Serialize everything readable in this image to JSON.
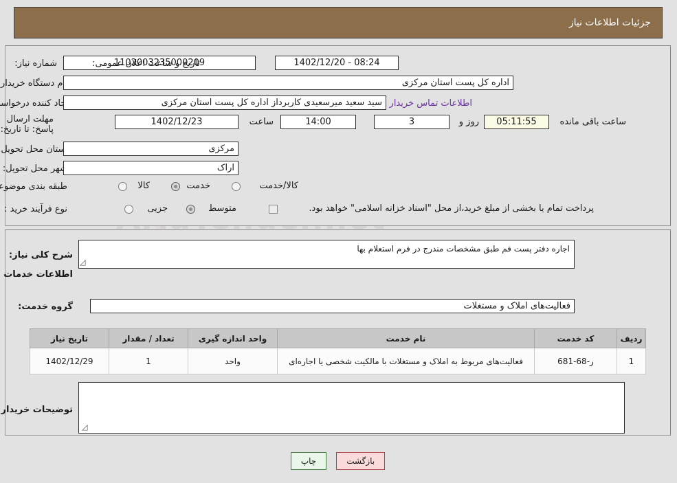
{
  "header": {
    "title": "جزئیات اطلاعات نیاز",
    "bg_color": "#8d6e4b"
  },
  "watermark": {
    "text": "AriaTender.net"
  },
  "form": {
    "need_number": {
      "label": "شماره نیاز:",
      "value": "1102003235000209"
    },
    "announce_datetime": {
      "label": "تاریخ و ساعت اعلان عمومی:",
      "value": "08:24 - 1402/12/20"
    },
    "buyer_org": {
      "label": "نام دستگاه خریدار:",
      "value": "اداره کل پست استان مرکزی"
    },
    "request_creator": {
      "label": "ایجاد کننده درخواست:",
      "value": "سید سعید میرسعیدی کاربرداز اداره کل پست استان مرکزی"
    },
    "buyer_contact_link": {
      "label": "اطلاعات تماس خریدار",
      "color": "#6b2fa5"
    },
    "deadline": {
      "label": "مهلت ارسال پاسخ: تا تاریخ:",
      "date": "1402/12/23",
      "time_label": "ساعت",
      "time": "14:00",
      "days": "3",
      "days_suffix": "روز و",
      "countdown": "05:11:55",
      "countdown_suffix": "ساعت باقی مانده"
    },
    "delivery_province": {
      "label": "استان محل تحویل:",
      "value": "مرکزی"
    },
    "delivery_city": {
      "label": "شهر محل تحویل:",
      "value": "اراک"
    },
    "subject_category": {
      "label": "طبقه بندی موضوعی:",
      "options": [
        {
          "label": "کالا",
          "selected": false
        },
        {
          "label": "خدمت",
          "selected": true
        },
        {
          "label": "کالا/خدمت",
          "selected": false
        }
      ]
    },
    "purchase_process": {
      "label": "نوع فرآیند خرید :",
      "options": [
        {
          "label": "جزیی",
          "selected": false
        },
        {
          "label": "متوسط",
          "selected": true
        }
      ]
    },
    "treasury_note": {
      "checked": false,
      "text": "پرداخت تمام یا بخشی از مبلغ خرید،از محل \"اسناد خزانه اسلامی\" خواهد بود."
    },
    "general_description": {
      "label": "شرح کلی نیاز:",
      "value": "اجاره دفتر پست فم طبق مشخصات مندرج در فرم استعلام بها"
    },
    "services_section_title": "اطلاعات خدمات مورد نیاز",
    "service_group": {
      "label": "گروه خدمت:",
      "value": "فعالیت‌های  املاک و مستغلات"
    },
    "buyer_comments": {
      "label": "توضیحات خریدار:",
      "value": ""
    }
  },
  "table": {
    "headers": [
      "ردیف",
      "کد خدمت",
      "نام خدمت",
      "واحد اندازه گیری",
      "تعداد / مقدار",
      "تاریخ نیاز"
    ],
    "rows": [
      {
        "index": "1",
        "code": "ر-68-681",
        "name": "فعالیت‌های مربوط به املاک و مستغلات با مالکیت شخصی یا اجاره‌ای",
        "unit": "واحد",
        "quantity": "1",
        "need_date": "1402/12/29"
      }
    ]
  },
  "buttons": {
    "back": {
      "label": "بازگشت",
      "bg": "#fadbdc",
      "border": "#a94442"
    },
    "print": {
      "label": "چاپ",
      "bg": "#eaf6ea",
      "border": "#3b7a3b"
    }
  }
}
